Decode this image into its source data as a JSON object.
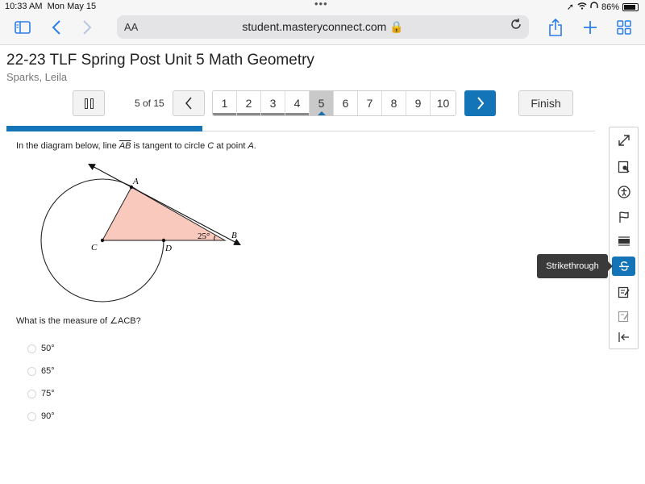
{
  "status": {
    "time": "10:33 AM",
    "date": "Mon May 15",
    "battery": "86%"
  },
  "browser": {
    "text_size_label": "AA",
    "url": "student.masteryconnect.com 🔒"
  },
  "header": {
    "title": "22-23 TLF Spring Post Unit 5 Math Geometry",
    "student": "Sparks, Leila"
  },
  "navigation": {
    "count": "5 of 15",
    "pages": [
      "1",
      "2",
      "3",
      "4",
      "5",
      "6",
      "7",
      "8",
      "9",
      "10"
    ],
    "current_page": 5,
    "finish_label": "Finish",
    "progress_fraction": 0.333
  },
  "question": {
    "prompt_before": "In the diagram below, line ",
    "prompt_segment": "AB",
    "prompt_middle": " is tangent to circle ",
    "prompt_circle": "C",
    "prompt_after_circle": " at point ",
    "prompt_point": "A",
    "prompt_end": ".",
    "ask": "What is the measure of ∠ACB?",
    "diagram": {
      "label_a": "A",
      "label_b": "B",
      "label_c": "C",
      "label_d": "D",
      "angle_label": "25°"
    },
    "choices": [
      "50°",
      "65°",
      "75°",
      "90°"
    ]
  },
  "tools": {
    "tooltip": "Strikethrough"
  },
  "colors": {
    "accent": "#1374b8",
    "triangle_fill": "#f9c9bd",
    "tooltip_bg": "#3a3a3a"
  }
}
